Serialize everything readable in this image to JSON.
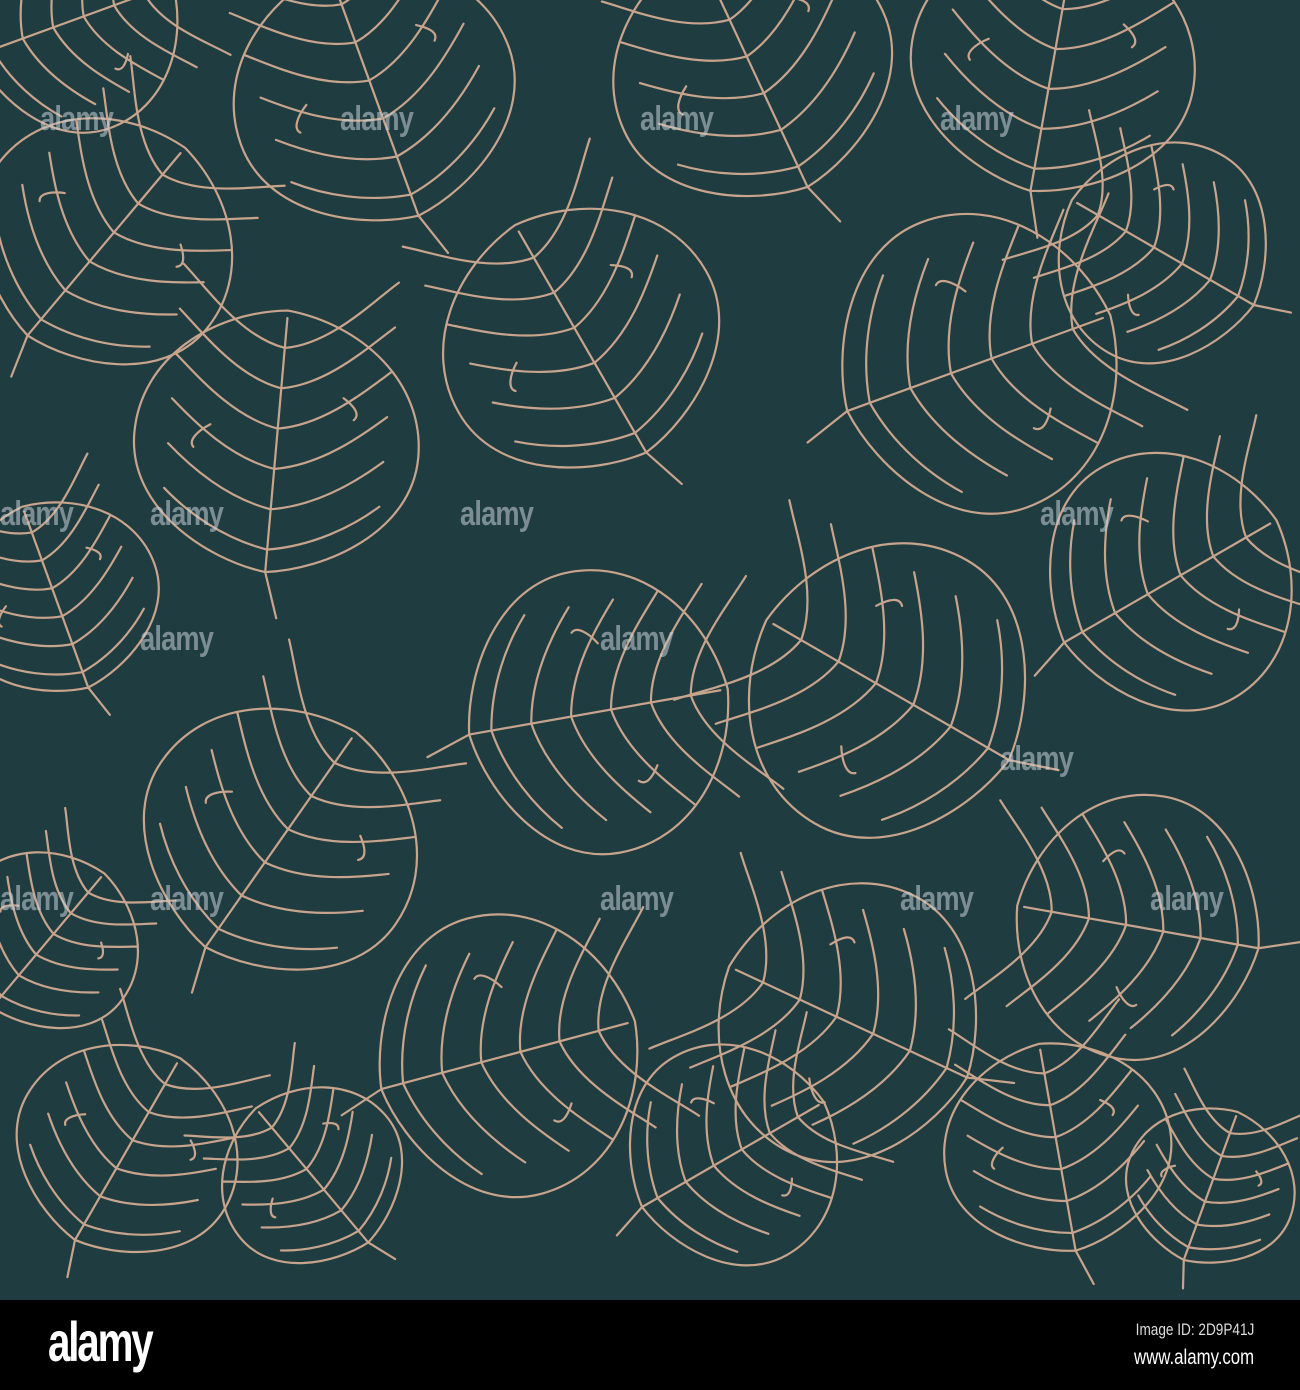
{
  "pattern": {
    "subject": "Monstera leaf outline seamless pattern",
    "background_color": "#1f3d41",
    "line_color": "#c9a48c"
  },
  "watermark": {
    "text": "alamy"
  },
  "footer": {
    "logo": "alamy",
    "image_id": "Image ID: 2D9P41J",
    "website": "www.alamy.com"
  }
}
